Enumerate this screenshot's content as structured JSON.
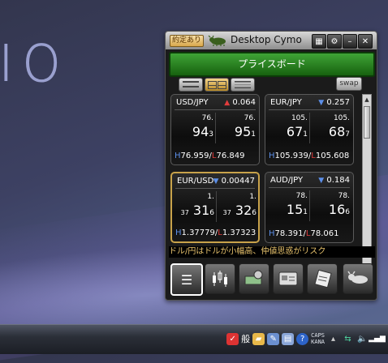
{
  "desktop": {
    "logo_text": "ıo"
  },
  "widget": {
    "badge": "約定あり",
    "title": "Desktop Cymo",
    "banner": "プライスボード",
    "swap_label": "swap",
    "ticker": "ドル/円はドルが小幅高、仲値思惑がリスク"
  },
  "tiles": [
    {
      "pair": "USD/JPY",
      "dir": "▲",
      "change": "0.064",
      "bid_prefix": "76.",
      "bid_pre": "",
      "bid_big": "94",
      "bid_pip": "3",
      "ask_prefix": "76.",
      "ask_pre": "",
      "ask_big": "95",
      "ask_pip": "1",
      "h_label": "H",
      "high": "76.959",
      "l_label": "L",
      "low": "76.849"
    },
    {
      "pair": "EUR/JPY",
      "dir": "▼",
      "change": "0.257",
      "bid_prefix": "105.",
      "bid_pre": "",
      "bid_big": "67",
      "bid_pip": "1",
      "ask_prefix": "105.",
      "ask_pre": "",
      "ask_big": "68",
      "ask_pip": "7",
      "h_label": "H",
      "high": "105.939",
      "l_label": "L",
      "low": "105.608"
    },
    {
      "pair": "EUR/USD",
      "dir": "▼",
      "change": "0.00447",
      "bid_prefix": "1.",
      "bid_pre": "37",
      "bid_big": "31",
      "bid_pip": "6",
      "ask_prefix": "1.",
      "ask_pre": "37",
      "ask_big": "32",
      "ask_pip": "6",
      "h_label": "H",
      "high": "1.37779",
      "l_label": "L",
      "low": "1.37323"
    },
    {
      "pair": "AUD/JPY",
      "dir": "▼",
      "change": "0.184",
      "bid_prefix": "78.",
      "bid_pre": "",
      "bid_big": "15",
      "bid_pip": "1",
      "ask_prefix": "78.",
      "ask_pre": "",
      "ask_big": "16",
      "ask_pip": "6",
      "h_label": "H",
      "high": "78.391",
      "l_label": "L",
      "low": "78.061"
    }
  ],
  "tray": {
    "ime": "般",
    "caps": "CAPS",
    "kana": "KANA"
  },
  "colors": {
    "banner_green": "#2b8a22",
    "up_red": "#e23c3c",
    "down_blue": "#5c8fe8",
    "selected_gold": "#c8a24a"
  }
}
